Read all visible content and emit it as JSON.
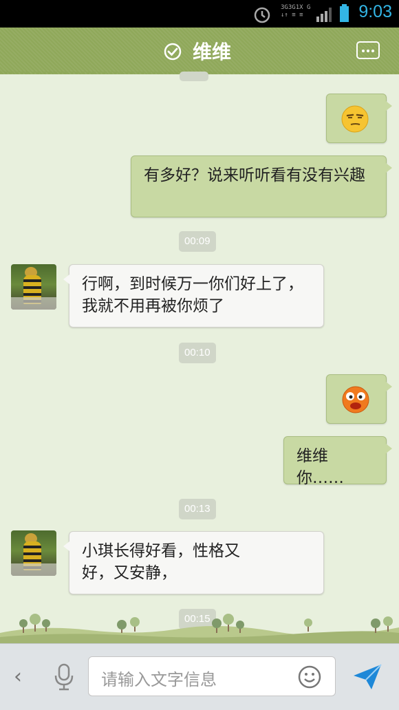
{
  "status_bar": {
    "time": "9:03",
    "network_labels": [
      "3G",
      "3G",
      "1X",
      "G"
    ]
  },
  "header": {
    "title": "维维",
    "check_icon": "check-circle-icon",
    "more_icon": "more-icon"
  },
  "messages": [
    {
      "type": "out",
      "kind": "emoji",
      "emoji": "smug-face-emoji"
    },
    {
      "type": "out",
      "kind": "text",
      "text": "有多好？说来听听看有没有兴趣"
    },
    {
      "type": "time",
      "text": "00:09"
    },
    {
      "type": "in",
      "kind": "text",
      "text": "行啊，到时候万一你们好上了，我就不用再被你烦了"
    },
    {
      "type": "time",
      "text": "00:10"
    },
    {
      "type": "out",
      "kind": "emoji",
      "emoji": "shocked-face-emoji"
    },
    {
      "type": "out",
      "kind": "text",
      "text": "维维你……"
    },
    {
      "type": "time",
      "text": "00:13"
    },
    {
      "type": "in",
      "kind": "text",
      "text": "小琪长得好看，性格又好，又安静，"
    },
    {
      "type": "time",
      "text": "00:15"
    }
  ],
  "input_bar": {
    "placeholder": "请输入文字信息"
  },
  "colors": {
    "header_green": "#8fa85a",
    "out_bubble": "#c8d9a3",
    "in_bubble": "#f7f7f5",
    "background": "#e8f0dd",
    "send_blue": "#1e88d8"
  }
}
